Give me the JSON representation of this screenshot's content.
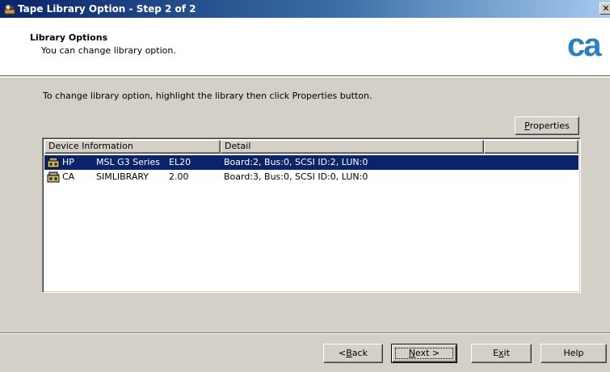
{
  "window": {
    "title": "Tape Library Option - Step 2 of 2",
    "close_label": "✕"
  },
  "header": {
    "title": "Library Options",
    "subtitle": "You can change library option.",
    "logo_text": "ca",
    "logo_color": "#2a7fbd"
  },
  "instruction": "To change library option, highlight the library then click Properties button.",
  "buttons": {
    "properties": {
      "pre": "",
      "accel": "P",
      "post": "roperties"
    },
    "back": {
      "pre": "< ",
      "accel": "B",
      "post": "ack"
    },
    "next": {
      "pre": "",
      "accel": "N",
      "post": "ext >"
    },
    "exit": {
      "pre": "E",
      "accel": "x",
      "post": "it"
    },
    "help": "Help"
  },
  "listview": {
    "columns": [
      "Device Information",
      "Detail",
      ""
    ],
    "rows": [
      {
        "vendor": "HP",
        "model": "MSL G3 Series",
        "revision": "EL20",
        "detail": "Board:2, Bus:0, SCSI ID:2, LUN:0",
        "icon": "tape-library-icon",
        "selected": true
      },
      {
        "vendor": "CA",
        "model": "SIMLIBRARY",
        "revision": "2.00",
        "detail": "Board:3, Bus:0, SCSI ID:0, LUN:0",
        "icon": "tape-library-icon",
        "selected": false
      }
    ]
  },
  "colors": {
    "selection": "#0a246a",
    "face": "#d4d0c8"
  }
}
